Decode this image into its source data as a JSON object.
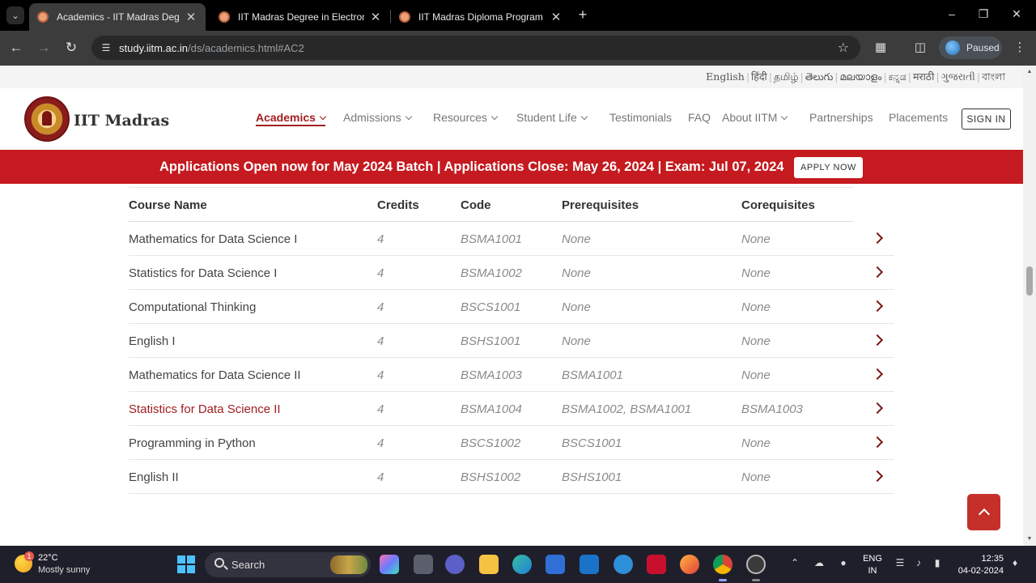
{
  "browser": {
    "tabs": [
      {
        "title": "Academics - IIT Madras Degree",
        "active": true
      },
      {
        "title": "IIT Madras Degree in Electronic",
        "active": false
      },
      {
        "title": "IIT Madras Diploma Program",
        "active": false
      }
    ],
    "new_tab": "+",
    "url_host": "study.iitm.ac.in",
    "url_path": "/ds/academics.html#AC2",
    "profile_label": "Paused"
  },
  "languages": [
    "English",
    "हिंदी",
    "தமிழ்",
    "తెలుగు",
    "മലയാളം",
    "ಕನ್ನಡ",
    "मराठी",
    "ગુજરાતી",
    "বাংলা"
  ],
  "header": {
    "brand": "IIT Madras",
    "nav": [
      "Academics",
      "Admissions",
      "Resources",
      "Student Life",
      "Testimonials",
      "FAQ",
      "About IITM",
      "Partnerships",
      "Placements"
    ],
    "signin": "SIGN IN"
  },
  "banner": {
    "text": "Applications Open now for May 2024 Batch | Applications Close: May 26, 2024 | Exam: Jul 07, 2024",
    "button": "APPLY NOW"
  },
  "table": {
    "headers": [
      "Course Name",
      "Credits",
      "Code",
      "Prerequisites",
      "Corequisites"
    ],
    "rows": [
      [
        "Mathematics for Data Science I",
        "4",
        "BSMA1001",
        "None",
        "None"
      ],
      [
        "Statistics for Data Science I",
        "4",
        "BSMA1002",
        "None",
        "None"
      ],
      [
        "Computational Thinking",
        "4",
        "BSCS1001",
        "None",
        "None"
      ],
      [
        "English I",
        "4",
        "BSHS1001",
        "None",
        "None"
      ],
      [
        "Mathematics for Data Science II",
        "4",
        "BSMA1003",
        "BSMA1001",
        "None"
      ],
      [
        "Statistics for Data Science II",
        "4",
        "BSMA1004",
        "BSMA1002, BSMA1001",
        "BSMA1003"
      ],
      [
        "Programming in Python",
        "4",
        "BSCS1002",
        "BSCS1001",
        "None"
      ],
      [
        "English II",
        "4",
        "BSHS1002",
        "BSHS1001",
        "None"
      ]
    ],
    "highlighted_row": 5
  },
  "taskbar": {
    "weather_temp": "22°C",
    "weather_desc": "Mostly sunny",
    "weather_badge": "1",
    "search_label": "Search",
    "lang_line1": "ENG",
    "lang_line2": "IN",
    "time": "12:35",
    "date": "04-02-2024"
  },
  "colors": {
    "brand_red": "#c51a1f",
    "accent_maroon": "#a11d21",
    "chrome_dark": "#3c3c3c"
  }
}
